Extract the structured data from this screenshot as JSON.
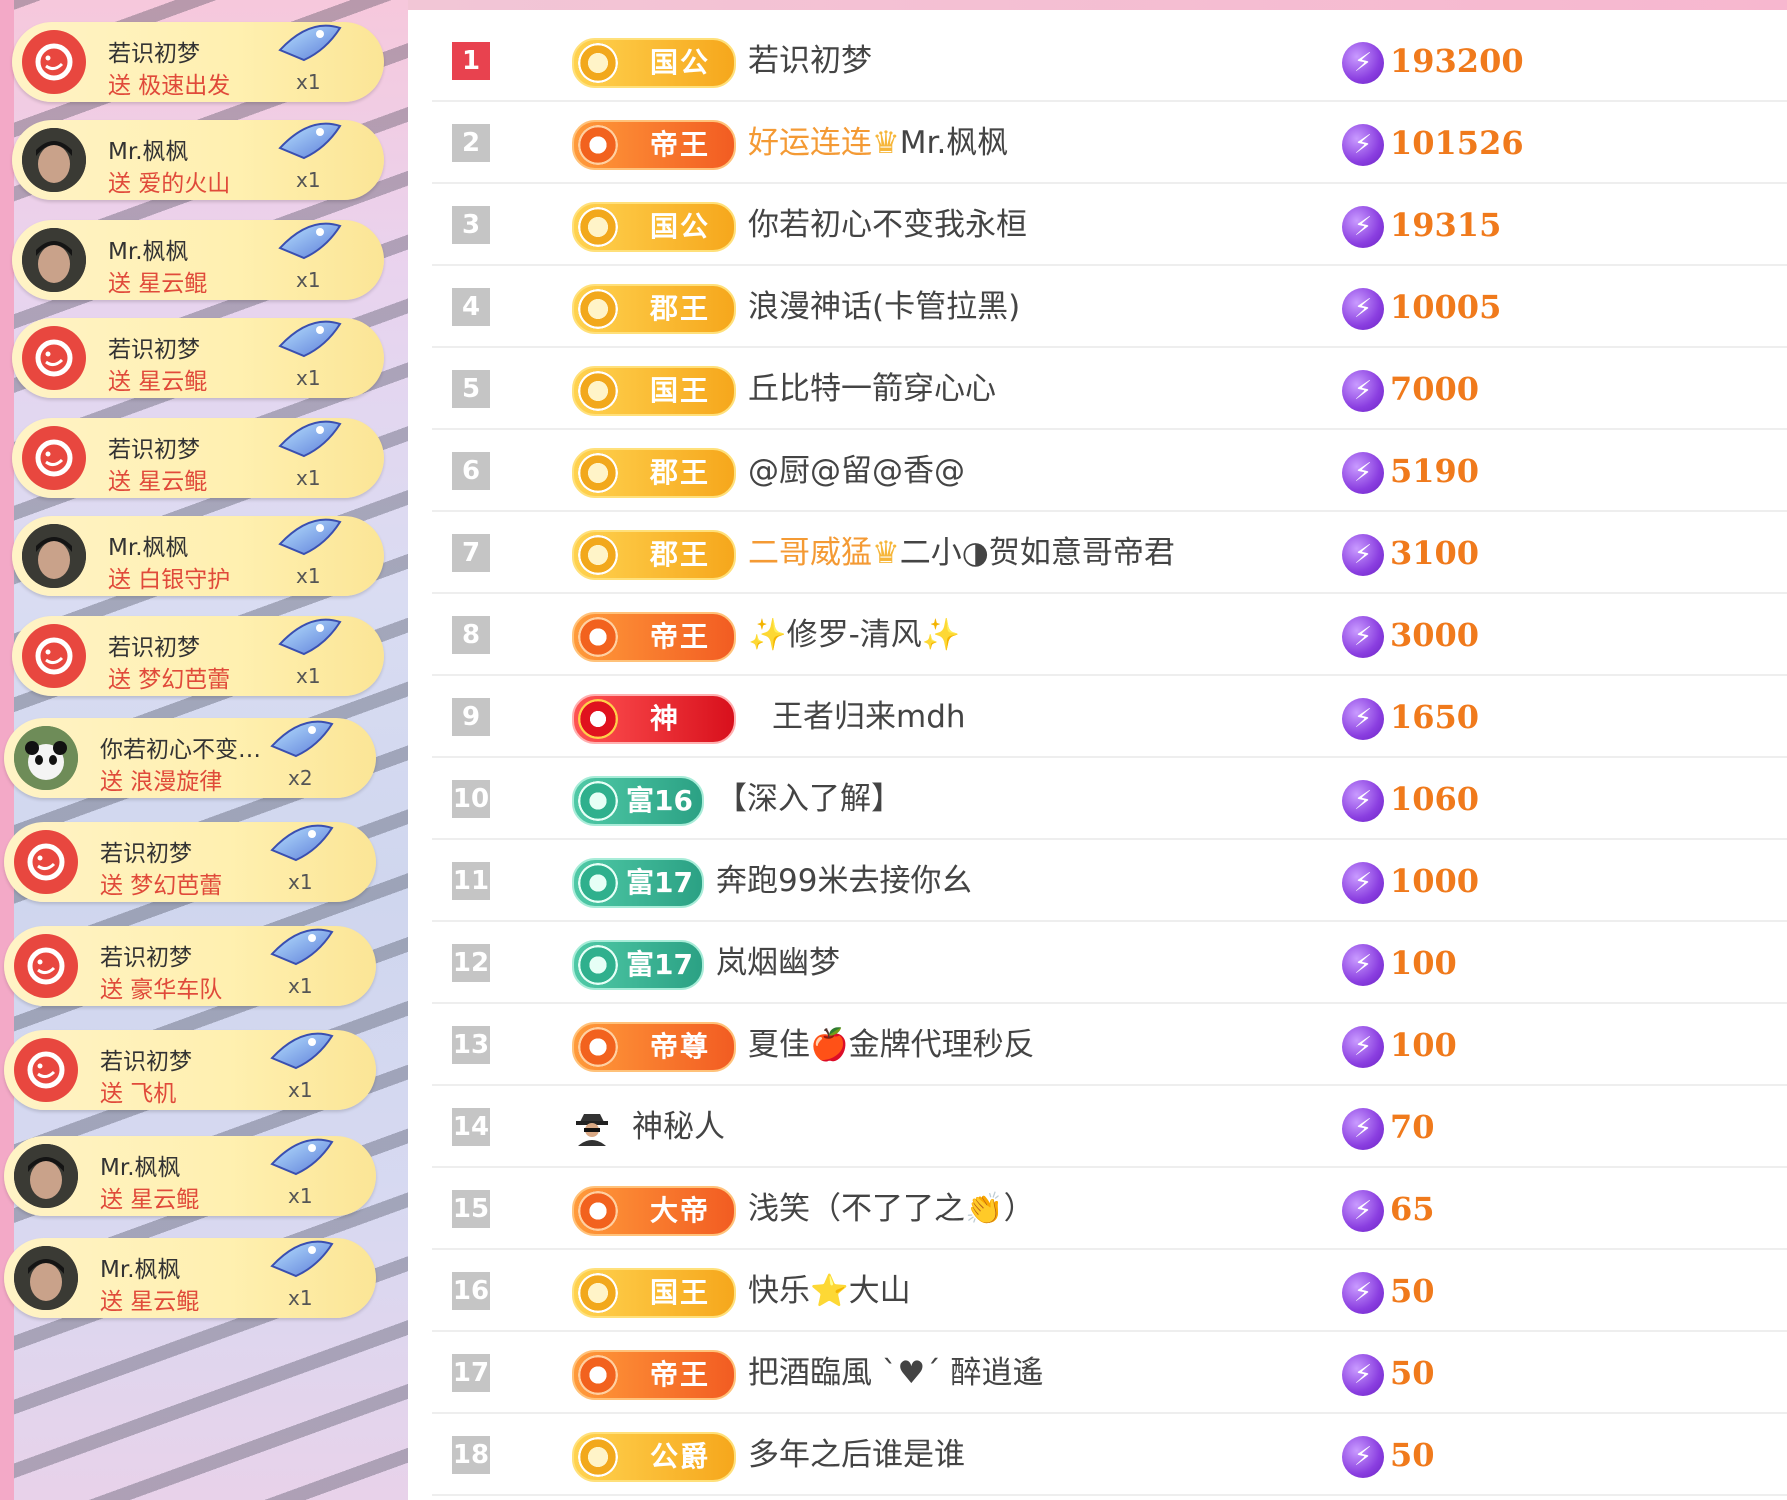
{
  "gift_feed": {
    "items": [
      {
        "name": "若识初梦",
        "sent": "送 极速出发",
        "count": "x1",
        "avatar": "red-logo",
        "gift_icon": "pink-car-icon"
      },
      {
        "name": "Mr.枫枫",
        "sent": "送 爱的火山",
        "count": "x1",
        "avatar": "face",
        "gift_icon": "love-volcano-icon"
      },
      {
        "name": "Mr.枫枫",
        "sent": "送 星云鲲",
        "count": "x1",
        "avatar": "face",
        "gift_icon": "nebula-whale-icon"
      },
      {
        "name": "若识初梦",
        "sent": "送 星云鲲",
        "count": "x1",
        "avatar": "red-logo",
        "gift_icon": "nebula-whale-icon"
      },
      {
        "name": "若识初梦",
        "sent": "送 星云鲲",
        "count": "x1",
        "avatar": "red-logo",
        "gift_icon": "nebula-whale-icon"
      },
      {
        "name": "Mr.枫枫",
        "sent": "送 白银守护",
        "count": "x1",
        "avatar": "face",
        "gift_icon": "silver-guard-icon"
      },
      {
        "name": "若识初梦",
        "sent": "送 梦幻芭蕾",
        "count": "x1",
        "avatar": "red-logo",
        "gift_icon": "dream-ballet-icon"
      },
      {
        "name": "你若初心不变…",
        "sent": "送 浪漫旋律",
        "count": "x2",
        "avatar": "panda",
        "gift_icon": "romantic-melody-icon"
      },
      {
        "name": "若识初梦",
        "sent": "送 梦幻芭蕾",
        "count": "x1",
        "avatar": "red-logo",
        "gift_icon": "dream-ballet-icon"
      },
      {
        "name": "若识初梦",
        "sent": "送 豪华车队",
        "count": "x1",
        "avatar": "red-logo",
        "gift_icon": "luxury-fleet-icon"
      },
      {
        "name": "若识初梦",
        "sent": "送 飞机",
        "count": "x1",
        "avatar": "red-logo",
        "gift_icon": "airplane-icon"
      },
      {
        "name": "Mr.枫枫",
        "sent": "送 星云鲲",
        "count": "x1",
        "avatar": "face",
        "gift_icon": "nebula-whale-icon"
      },
      {
        "name": "Mr.枫枫",
        "sent": "送 星云鲲",
        "count": "x1",
        "avatar": "face",
        "gift_icon": "nebula-whale-icon"
      }
    ]
  },
  "ranking": {
    "rows": [
      {
        "rank": "1",
        "badge": "国公",
        "badge_style": "gold",
        "name": "若识初梦",
        "name_hl": "",
        "name_rest": "",
        "score": "193200"
      },
      {
        "rank": "2",
        "badge": "帝王",
        "badge_style": "orange",
        "name": "",
        "name_hl": "好运连连",
        "name_rest": "Mr.枫枫",
        "score": "101526"
      },
      {
        "rank": "3",
        "badge": "国公",
        "badge_style": "gold",
        "name": "你若初心不变我永桓",
        "name_hl": "",
        "name_rest": "",
        "score": "19315"
      },
      {
        "rank": "4",
        "badge": "郡王",
        "badge_style": "gold",
        "name": "浪漫神话(卡管拉黑)",
        "name_hl": "",
        "name_rest": "",
        "score": "10005"
      },
      {
        "rank": "5",
        "badge": "国王",
        "badge_style": "gold",
        "name": "丘比特一箭穿心心",
        "name_hl": "",
        "name_rest": "",
        "score": "7000"
      },
      {
        "rank": "6",
        "badge": "郡王",
        "badge_style": "gold",
        "name": "@厨@留@香@",
        "name_hl": "",
        "name_rest": "",
        "score": "5190"
      },
      {
        "rank": "7",
        "badge": "郡王",
        "badge_style": "gold",
        "name": "",
        "name_hl": "二哥威猛",
        "name_rest": "二小◑贺如意哥帝君",
        "score": "3100"
      },
      {
        "rank": "8",
        "badge": "帝王",
        "badge_style": "orange",
        "name": "✨修罗-清风✨",
        "name_hl": "",
        "name_rest": "",
        "score": "3000"
      },
      {
        "rank": "9",
        "badge": "神",
        "badge_style": "red",
        "name": "王者归来mdh",
        "name_hl": "",
        "name_rest": "",
        "score": "1650"
      },
      {
        "rank": "10",
        "badge": "富16",
        "badge_style": "teal",
        "name": "【深入了解】",
        "name_hl": "",
        "name_rest": "",
        "score": "1060"
      },
      {
        "rank": "11",
        "badge": "富17",
        "badge_style": "teal",
        "name": "奔跑99米去接你幺",
        "name_hl": "",
        "name_rest": "",
        "score": "1000"
      },
      {
        "rank": "12",
        "badge": "富17",
        "badge_style": "teal",
        "name": "岚烟幽梦",
        "name_hl": "",
        "name_rest": "",
        "score": "100"
      },
      {
        "rank": "13",
        "badge": "帝尊",
        "badge_style": "orange",
        "name": "夏佳🍎金牌代理秒反",
        "name_hl": "",
        "name_rest": "",
        "score": "100"
      },
      {
        "rank": "14",
        "badge": "",
        "badge_style": "spy",
        "name": "神秘人",
        "name_hl": "",
        "name_rest": "",
        "score": "70"
      },
      {
        "rank": "15",
        "badge": "大帝",
        "badge_style": "orange",
        "name": "浅笑（不了了之👏）",
        "name_hl": "",
        "name_rest": "",
        "score": "65"
      },
      {
        "rank": "16",
        "badge": "国王",
        "badge_style": "gold",
        "name": "快乐⭐大山",
        "name_hl": "",
        "name_rest": "",
        "score": "50"
      },
      {
        "rank": "17",
        "badge": "帝王",
        "badge_style": "orange",
        "name": "把酒臨風 ˋ♥ˊ 醉逍遙",
        "name_hl": "",
        "name_rest": "",
        "score": "50"
      },
      {
        "rank": "18",
        "badge": "公爵",
        "badge_style": "gold",
        "name": "多年之后谁是谁",
        "name_hl": "",
        "name_rest": "",
        "score": "50"
      }
    ],
    "coin_icon": "lightning-coin-icon",
    "colors": {
      "score": "#f07a1c",
      "highlight_name": "#f49a34",
      "rank_first": "#e8424f",
      "rank_other": "#c5c5c5"
    }
  }
}
